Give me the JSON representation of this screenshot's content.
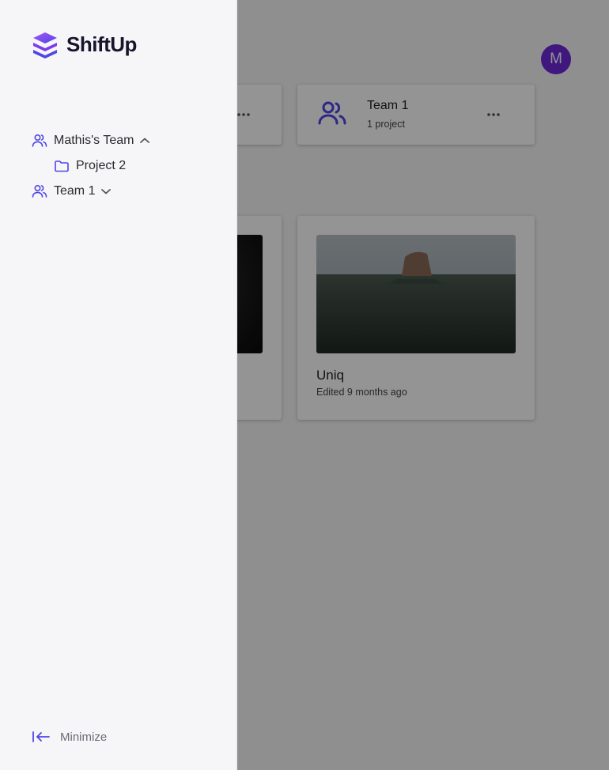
{
  "app": {
    "avatar_initial": "M",
    "teams": [
      {
        "name": "Team 1",
        "subtitle": "1 project"
      }
    ],
    "projects": [
      {
        "name": "Uniq",
        "edited": "Edited 9 months ago"
      }
    ]
  },
  "sidebar": {
    "brand": "ShiftUp",
    "items": [
      {
        "label": "Mathis's Team",
        "icon": "users-icon",
        "expanded": true,
        "children": [
          {
            "label": "Project 2",
            "icon": "folder-icon"
          }
        ]
      },
      {
        "label": "Team 1",
        "icon": "users-icon",
        "expanded": false
      }
    ],
    "minimize_label": "Minimize"
  },
  "colors": {
    "accent": "#4f46e5",
    "avatar": "#6d28d9",
    "overlay": "rgba(0,0,0,0.42)"
  }
}
